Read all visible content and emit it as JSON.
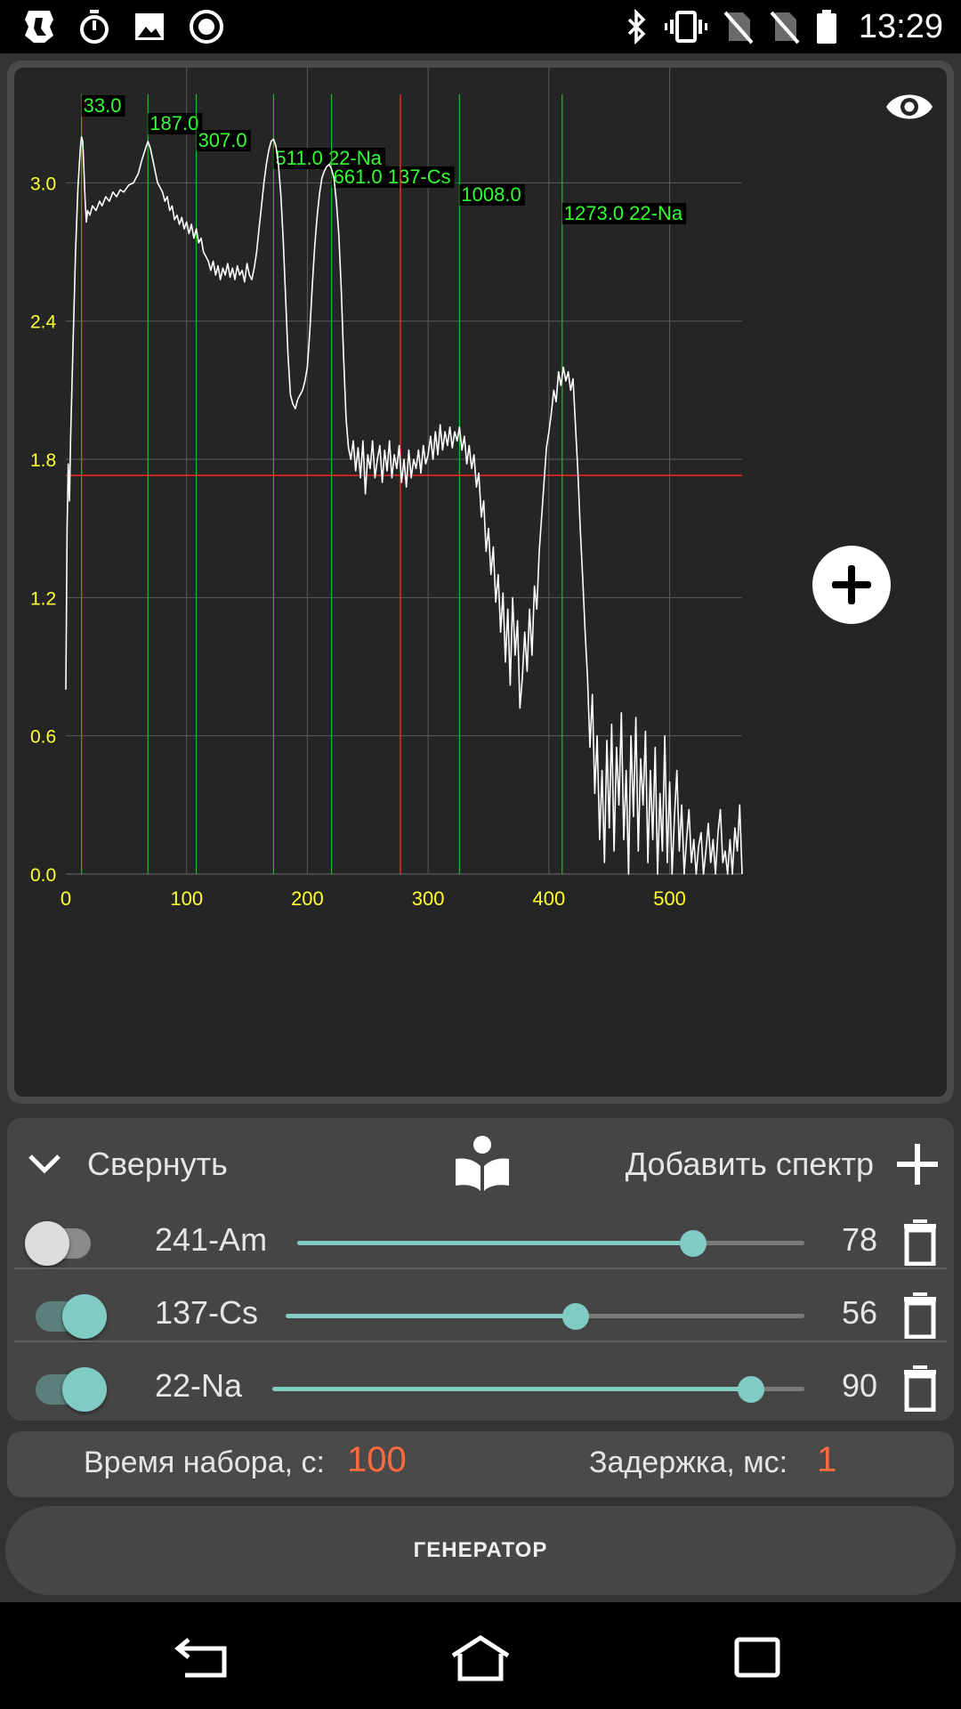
{
  "status_bar": {
    "time": "13:29",
    "left_icons": [
      "app-logo-icon",
      "stopwatch-icon",
      "image-icon",
      "record-icon"
    ],
    "right_icons": [
      "bluetooth-icon",
      "vibrate-icon",
      "no-sim-icon",
      "no-sim-icon",
      "battery-icon"
    ]
  },
  "chart_data": {
    "type": "line",
    "x_ticks": [
      "0",
      "100",
      "200",
      "300",
      "400",
      "500"
    ],
    "y_ticks": [
      "0.0",
      "0.6",
      "1.2",
      "1.8",
      "2.4",
      "3.0"
    ],
    "xlim": [
      0,
      560
    ],
    "ylim": [
      0,
      3.5
    ],
    "grid": true,
    "colors": {
      "line": "#ffffff",
      "tick": "#ffff33",
      "marker": "#22bb22",
      "marker_label": "#33ff33",
      "crosshair": "#ff2222"
    },
    "markers": [
      {
        "x": 13,
        "label": "33.0"
      },
      {
        "x": 68,
        "label": "187.0"
      },
      {
        "x": 108,
        "label": "307.0"
      },
      {
        "x": 172,
        "label": "511.0  22-Na"
      },
      {
        "x": 220,
        "label": "661.0  137-Cs"
      },
      {
        "x": 326,
        "label": "1008.0"
      },
      {
        "x": 411,
        "label": "1273.0  22-Na"
      }
    ],
    "crosshair": {
      "x": 277,
      "y": 1.73
    },
    "series": [
      {
        "values": [
          [
            0,
            0.8
          ],
          [
            1,
            1.5
          ],
          [
            2,
            1.78
          ],
          [
            3,
            1.62
          ],
          [
            4,
            1.9
          ],
          [
            6,
            2.3
          ],
          [
            8,
            2.7
          ],
          [
            10,
            2.98
          ],
          [
            12,
            3.15
          ],
          [
            13,
            3.2
          ],
          [
            14,
            3.18
          ],
          [
            15,
            3.05
          ],
          [
            16,
            2.92
          ],
          [
            17,
            2.83
          ],
          [
            18,
            2.88
          ],
          [
            20,
            2.86
          ],
          [
            22,
            2.9
          ],
          [
            25,
            2.88
          ],
          [
            28,
            2.92
          ],
          [
            30,
            2.9
          ],
          [
            33,
            2.94
          ],
          [
            36,
            2.92
          ],
          [
            39,
            2.96
          ],
          [
            42,
            2.94
          ],
          [
            45,
            2.97
          ],
          [
            48,
            2.96
          ],
          [
            52,
            2.99
          ],
          [
            56,
            3.0
          ],
          [
            60,
            3.04
          ],
          [
            63,
            3.1
          ],
          [
            66,
            3.15
          ],
          [
            68,
            3.18
          ],
          [
            70,
            3.15
          ],
          [
            72,
            3.1
          ],
          [
            74,
            3.05
          ],
          [
            76,
            3.0
          ],
          [
            78,
            2.98
          ],
          [
            80,
            2.96
          ],
          [
            82,
            2.92
          ],
          [
            84,
            2.94
          ],
          [
            86,
            2.88
          ],
          [
            88,
            2.9
          ],
          [
            90,
            2.84
          ],
          [
            92,
            2.86
          ],
          [
            94,
            2.82
          ],
          [
            96,
            2.85
          ],
          [
            98,
            2.8
          ],
          [
            100,
            2.83
          ],
          [
            102,
            2.78
          ],
          [
            104,
            2.82
          ],
          [
            106,
            2.76
          ],
          [
            108,
            2.8
          ],
          [
            110,
            2.74
          ],
          [
            112,
            2.76
          ],
          [
            114,
            2.7
          ],
          [
            116,
            2.68
          ],
          [
            118,
            2.66
          ],
          [
            120,
            2.62
          ],
          [
            122,
            2.66
          ],
          [
            124,
            2.6
          ],
          [
            126,
            2.64
          ],
          [
            128,
            2.58
          ],
          [
            130,
            2.63
          ],
          [
            132,
            2.6
          ],
          [
            134,
            2.65
          ],
          [
            136,
            2.59
          ],
          [
            138,
            2.63
          ],
          [
            140,
            2.58
          ],
          [
            142,
            2.64
          ],
          [
            144,
            2.6
          ],
          [
            146,
            2.62
          ],
          [
            148,
            2.57
          ],
          [
            150,
            2.65
          ],
          [
            152,
            2.6
          ],
          [
            154,
            2.58
          ],
          [
            156,
            2.63
          ],
          [
            158,
            2.7
          ],
          [
            160,
            2.8
          ],
          [
            162,
            2.9
          ],
          [
            164,
            3.0
          ],
          [
            166,
            3.08
          ],
          [
            168,
            3.14
          ],
          [
            170,
            3.18
          ],
          [
            172,
            3.19
          ],
          [
            174,
            3.16
          ],
          [
            176,
            3.08
          ],
          [
            178,
            2.95
          ],
          [
            180,
            2.75
          ],
          [
            182,
            2.5
          ],
          [
            184,
            2.25
          ],
          [
            186,
            2.08
          ],
          [
            188,
            2.04
          ],
          [
            190,
            2.02
          ],
          [
            192,
            2.06
          ],
          [
            194,
            2.08
          ],
          [
            196,
            2.1
          ],
          [
            198,
            2.14
          ],
          [
            200,
            2.2
          ],
          [
            202,
            2.35
          ],
          [
            204,
            2.55
          ],
          [
            206,
            2.72
          ],
          [
            208,
            2.85
          ],
          [
            210,
            2.95
          ],
          [
            212,
            3.02
          ],
          [
            214,
            3.05
          ],
          [
            216,
            3.07
          ],
          [
            218,
            3.08
          ],
          [
            220,
            3.06
          ],
          [
            222,
            3.02
          ],
          [
            224,
            2.92
          ],
          [
            226,
            2.78
          ],
          [
            228,
            2.55
          ],
          [
            230,
            2.25
          ],
          [
            232,
            1.98
          ],
          [
            234,
            1.85
          ],
          [
            236,
            1.8
          ],
          [
            238,
            1.88
          ],
          [
            240,
            1.75
          ],
          [
            242,
            1.85
          ],
          [
            244,
            1.72
          ],
          [
            246,
            1.88
          ],
          [
            248,
            1.65
          ],
          [
            250,
            1.82
          ],
          [
            252,
            1.76
          ],
          [
            254,
            1.88
          ],
          [
            256,
            1.72
          ],
          [
            258,
            1.8
          ],
          [
            260,
            1.86
          ],
          [
            262,
            1.7
          ],
          [
            264,
            1.84
          ],
          [
            266,
            1.75
          ],
          [
            268,
            1.88
          ],
          [
            270,
            1.72
          ],
          [
            272,
            1.82
          ],
          [
            274,
            1.76
          ],
          [
            276,
            1.86
          ],
          [
            278,
            1.7
          ],
          [
            280,
            1.8
          ],
          [
            282,
            1.68
          ],
          [
            284,
            1.84
          ],
          [
            286,
            1.72
          ],
          [
            288,
            1.8
          ],
          [
            290,
            1.76
          ],
          [
            292,
            1.84
          ],
          [
            294,
            1.74
          ],
          [
            296,
            1.86
          ],
          [
            298,
            1.78
          ],
          [
            300,
            1.82
          ],
          [
            302,
            1.9
          ],
          [
            304,
            1.8
          ],
          [
            306,
            1.92
          ],
          [
            308,
            1.82
          ],
          [
            310,
            1.95
          ],
          [
            312,
            1.84
          ],
          [
            314,
            1.92
          ],
          [
            316,
            1.86
          ],
          [
            318,
            1.94
          ],
          [
            320,
            1.85
          ],
          [
            322,
            1.92
          ],
          [
            324,
            1.88
          ],
          [
            326,
            1.94
          ],
          [
            328,
            1.84
          ],
          [
            330,
            1.9
          ],
          [
            332,
            1.78
          ],
          [
            334,
            1.86
          ],
          [
            336,
            1.76
          ],
          [
            338,
            1.82
          ],
          [
            340,
            1.68
          ],
          [
            342,
            1.74
          ],
          [
            344,
            1.55
          ],
          [
            346,
            1.62
          ],
          [
            348,
            1.4
          ],
          [
            350,
            1.5
          ],
          [
            352,
            1.3
          ],
          [
            354,
            1.42
          ],
          [
            356,
            1.18
          ],
          [
            358,
            1.3
          ],
          [
            360,
            1.05
          ],
          [
            362,
            1.22
          ],
          [
            364,
            0.92
          ],
          [
            366,
            1.15
          ],
          [
            368,
            0.82
          ],
          [
            370,
            1.2
          ],
          [
            372,
            0.95
          ],
          [
            374,
            1.1
          ],
          [
            376,
            0.72
          ],
          [
            378,
            0.85
          ],
          [
            380,
            1.05
          ],
          [
            382,
            0.88
          ],
          [
            384,
            1.15
          ],
          [
            386,
            0.95
          ],
          [
            388,
            1.25
          ],
          [
            390,
            1.15
          ],
          [
            392,
            1.4
          ],
          [
            394,
            1.55
          ],
          [
            396,
            1.7
          ],
          [
            398,
            1.85
          ],
          [
            400,
            1.92
          ],
          [
            402,
            2.0
          ],
          [
            404,
            2.1
          ],
          [
            406,
            2.05
          ],
          [
            408,
            2.18
          ],
          [
            410,
            2.12
          ],
          [
            412,
            2.2
          ],
          [
            414,
            2.14
          ],
          [
            416,
            2.18
          ],
          [
            418,
            2.1
          ],
          [
            420,
            2.15
          ],
          [
            422,
            1.95
          ],
          [
            424,
            1.75
          ],
          [
            426,
            1.5
          ],
          [
            428,
            1.28
          ],
          [
            430,
            1.05
          ],
          [
            432,
            0.85
          ],
          [
            434,
            0.55
          ],
          [
            436,
            0.78
          ],
          [
            438,
            0.35
          ],
          [
            440,
            0.6
          ],
          [
            442,
            0.15
          ],
          [
            444,
            0.45
          ],
          [
            446,
            0.05
          ],
          [
            448,
            0.58
          ],
          [
            450,
            0.2
          ],
          [
            452,
            0.65
          ],
          [
            454,
            0.1
          ],
          [
            456,
            0.55
          ],
          [
            458,
            0.3
          ],
          [
            460,
            0.7
          ],
          [
            462,
            0.15
          ],
          [
            464,
            0.45
          ],
          [
            466,
            0.0
          ],
          [
            468,
            0.6
          ],
          [
            470,
            0.25
          ],
          [
            472,
            0.68
          ],
          [
            474,
            0.1
          ],
          [
            476,
            0.5
          ],
          [
            478,
            0.3
          ],
          [
            480,
            0.62
          ],
          [
            482,
            0.05
          ],
          [
            484,
            0.45
          ],
          [
            486,
            0.15
          ],
          [
            488,
            0.55
          ],
          [
            490,
            0.0
          ],
          [
            492,
            0.35
          ],
          [
            494,
            0.1
          ],
          [
            496,
            0.6
          ],
          [
            498,
            0.05
          ],
          [
            500,
            0.4
          ],
          [
            502,
            0.0
          ],
          [
            504,
            0.25
          ],
          [
            506,
            0.45
          ],
          [
            508,
            0.1
          ],
          [
            510,
            0.3
          ],
          [
            512,
            0.0
          ],
          [
            514,
            0.15
          ],
          [
            516,
            0.28
          ],
          [
            518,
            0.05
          ],
          [
            520,
            0.15
          ],
          [
            522,
            0.0
          ],
          [
            524,
            0.12
          ],
          [
            526,
            0.18
          ],
          [
            528,
            0.0
          ],
          [
            530,
            0.1
          ],
          [
            532,
            0.22
          ],
          [
            534,
            0.05
          ],
          [
            536,
            0.15
          ],
          [
            538,
            0.0
          ],
          [
            540,
            0.18
          ],
          [
            542,
            0.28
          ],
          [
            544,
            0.05
          ],
          [
            546,
            0.1
          ],
          [
            548,
            0.0
          ],
          [
            550,
            0.15
          ],
          [
            552,
            0.0
          ],
          [
            554,
            0.2
          ],
          [
            556,
            0.1
          ],
          [
            558,
            0.3
          ],
          [
            560,
            0.0
          ]
        ]
      }
    ]
  },
  "spectra_panel": {
    "collapse_label": "Свернуть",
    "add_spectrum_label": "Добавить спектр",
    "icons": {
      "collapse": "chevron-down-icon",
      "library": "book-icon",
      "add": "plus-icon",
      "delete": "trash-icon"
    },
    "rows": [
      {
        "name": "241-Am",
        "enabled": false,
        "value": "78",
        "level": 78
      },
      {
        "name": "137-Cs",
        "enabled": true,
        "value": "56",
        "level": 56
      },
      {
        "name": "22-Na",
        "enabled": true,
        "value": "90",
        "level": 90
      }
    ]
  },
  "params": {
    "time_label": "Время набора, с:",
    "time_value": "100",
    "delay_label": "Задержка, мс:",
    "delay_value": "1"
  },
  "generator_button": "ГЕНЕРАТОР",
  "nav_bar": {
    "icons": [
      "back-icon",
      "home-icon",
      "recents-icon"
    ]
  },
  "colors": {
    "accent": "#80cbc4",
    "value_text": "#ff6a3d"
  }
}
